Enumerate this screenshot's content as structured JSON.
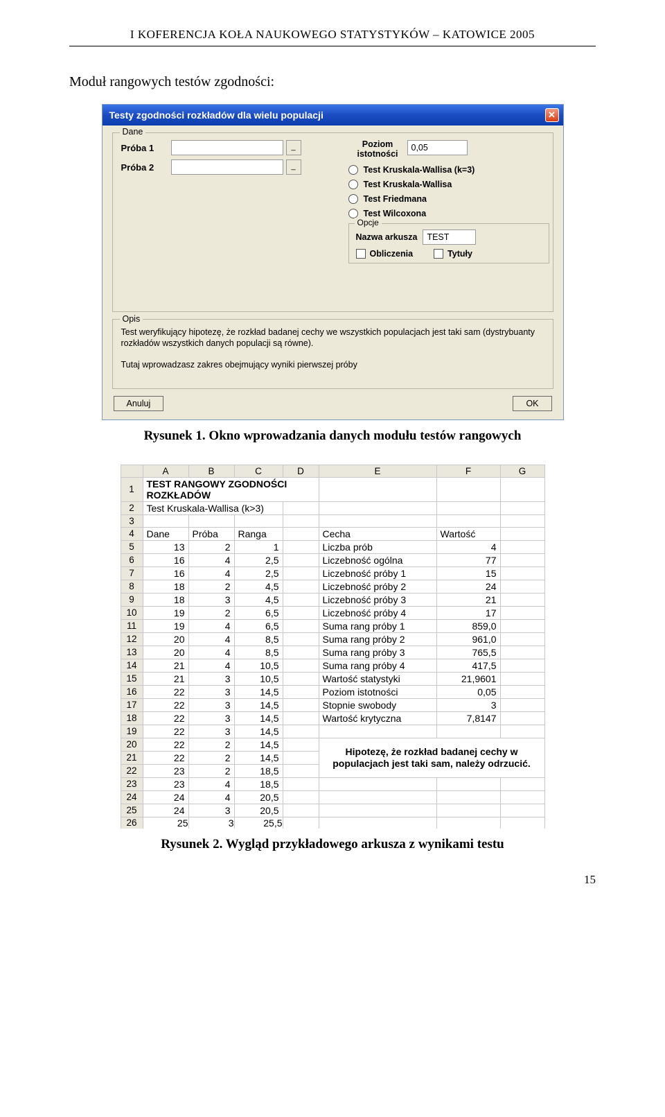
{
  "header": "I KOFERENCJA KOŁA NAUKOWEGO STATYSTYKÓW – KATOWICE 2005",
  "intro": "Moduł rangowych testów zgodności:",
  "caption1": "Rysunek 1. Okno wprowadzania danych modułu testów rangowych",
  "caption2": "Rysunek 2. Wygląd przykładowego arkusza z wynikami testu",
  "page_num": "15",
  "dialog": {
    "title": "Testy zgodności rozkładów dla wielu populacji",
    "close": "✕",
    "dane_legend": "Dane",
    "proba1": "Próba 1",
    "proba2": "Próba 2",
    "minibtn": "_",
    "poziom_label": "Poziom istotności",
    "poziom_value": "0,05",
    "radios": [
      "Test Kruskala-Wallisa (k=3)",
      "Test Kruskala-Wallisa",
      "Test Friedmana",
      "Test Wilcoxona"
    ],
    "opcje_legend": "Opcje",
    "nazwa_arkusza_lbl": "Nazwa arkusza",
    "nazwa_arkusza_val": "TEST",
    "check_obliczenia": "Obliczenia",
    "check_tytuly": "Tytuły",
    "opis_legend": "Opis",
    "opis_p1": "Test weryfikujący hipotezę, że rozkład badanej cechy we wszystkich populacjach jest taki sam (dystrybuanty rozkładów wszystkich danych populacji są równe).",
    "opis_p2": "Tutaj wprowadzasz zakres obejmujący wyniki pierwszej próby",
    "btn_anuluj": "Anuluj",
    "btn_ok": "OK"
  },
  "sheet": {
    "cols": [
      "A",
      "B",
      "C",
      "D",
      "E",
      "F",
      "G"
    ],
    "row1_title": "TEST RANGOWY ZGODNOŚCI ROZKŁADÓW",
    "row2_title": "Test Kruskala-Wallisa (k>3)",
    "row4": {
      "A": "Dane",
      "B": "Próba",
      "C": "Ranga",
      "E": "Cecha",
      "F": "Wartość"
    },
    "data": [
      {
        "n": 5,
        "A": "13",
        "B": "2",
        "C": "1",
        "E": "Liczba prób",
        "F": "4"
      },
      {
        "n": 6,
        "A": "16",
        "B": "4",
        "C": "2,5",
        "E": "Liczebność ogólna",
        "F": "77"
      },
      {
        "n": 7,
        "A": "16",
        "B": "4",
        "C": "2,5",
        "E": "Liczebność próby  1",
        "F": "15"
      },
      {
        "n": 8,
        "A": "18",
        "B": "2",
        "C": "4,5",
        "E": "Liczebność próby  2",
        "F": "24"
      },
      {
        "n": 9,
        "A": "18",
        "B": "3",
        "C": "4,5",
        "E": "Liczebność próby  3",
        "F": "21"
      },
      {
        "n": 10,
        "A": "19",
        "B": "2",
        "C": "6,5",
        "E": "Liczebność próby  4",
        "F": "17"
      },
      {
        "n": 11,
        "A": "19",
        "B": "4",
        "C": "6,5",
        "E": "Suma rang próby  1",
        "F": "859,0"
      },
      {
        "n": 12,
        "A": "20",
        "B": "4",
        "C": "8,5",
        "E": "Suma rang próby  2",
        "F": "961,0"
      },
      {
        "n": 13,
        "A": "20",
        "B": "4",
        "C": "8,5",
        "E": "Suma rang próby  3",
        "F": "765,5"
      },
      {
        "n": 14,
        "A": "21",
        "B": "4",
        "C": "10,5",
        "E": "Suma rang próby  4",
        "F": "417,5"
      },
      {
        "n": 15,
        "A": "21",
        "B": "3",
        "C": "10,5",
        "E": "Wartość statystyki",
        "F": "21,9601"
      },
      {
        "n": 16,
        "A": "22",
        "B": "3",
        "C": "14,5",
        "E": "Poziom istotności",
        "F": "0,05"
      },
      {
        "n": 17,
        "A": "22",
        "B": "3",
        "C": "14,5",
        "E": "Stopnie swobody",
        "F": "3"
      },
      {
        "n": 18,
        "A": "22",
        "B": "3",
        "C": "14,5",
        "E": "Wartość krytyczna",
        "F": "7,8147"
      },
      {
        "n": 19,
        "A": "22",
        "B": "3",
        "C": "14,5",
        "E": "",
        "F": ""
      }
    ],
    "merged_text": "Hipotezę, że rozkład badanej cechy w populacjach jest taki sam, należy odrzucić.",
    "tail": [
      {
        "n": 20,
        "A": "22",
        "B": "2",
        "C": "14,5"
      },
      {
        "n": 21,
        "A": "22",
        "B": "2",
        "C": "14,5"
      },
      {
        "n": 22,
        "A": "23",
        "B": "2",
        "C": "18,5"
      },
      {
        "n": 23,
        "A": "23",
        "B": "4",
        "C": "18,5"
      },
      {
        "n": 24,
        "A": "24",
        "B": "4",
        "C": "20,5"
      },
      {
        "n": 25,
        "A": "24",
        "B": "3",
        "C": "20,5"
      }
    ],
    "last": {
      "n": "26",
      "A": "25",
      "B": "3",
      "C": "25,5"
    }
  }
}
